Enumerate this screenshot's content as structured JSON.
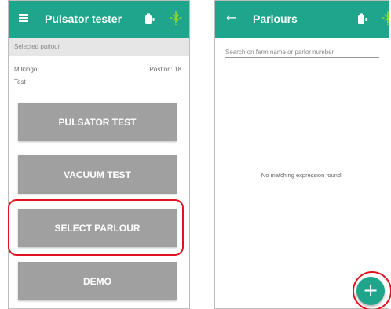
{
  "colors": {
    "appbar": "#1fa58c",
    "button": "#a0a0a0",
    "highlight": "#e0141e",
    "bluetooth": "#8bd62c"
  },
  "left_screen": {
    "appbar": {
      "title": "Pulsator tester",
      "nav_icon": "menu-icon",
      "status_icons": [
        "device-battery-icon",
        "bluetooth-icon"
      ]
    },
    "selected_parlour": {
      "heading": "Selected parlour",
      "farm_name": "Milkingo",
      "post_nr": "Post nr.: 18",
      "subtitle": "Test"
    },
    "buttons": {
      "pulsator_test": "PULSATOR TEST",
      "vacuum_test": "VACUUM TEST",
      "select_parlour": "SELECT PARLOUR",
      "demo": "DEMO"
    }
  },
  "right_screen": {
    "appbar": {
      "title": "Parlours",
      "nav_icon": "arrow-back-icon",
      "status_icons": [
        "device-battery-icon",
        "bluetooth-icon"
      ]
    },
    "search": {
      "placeholder": "Search on farm name or parlor number",
      "value": ""
    },
    "empty_message": "No matching expression found!",
    "fab": {
      "icon": "plus-icon",
      "label": "+"
    }
  }
}
